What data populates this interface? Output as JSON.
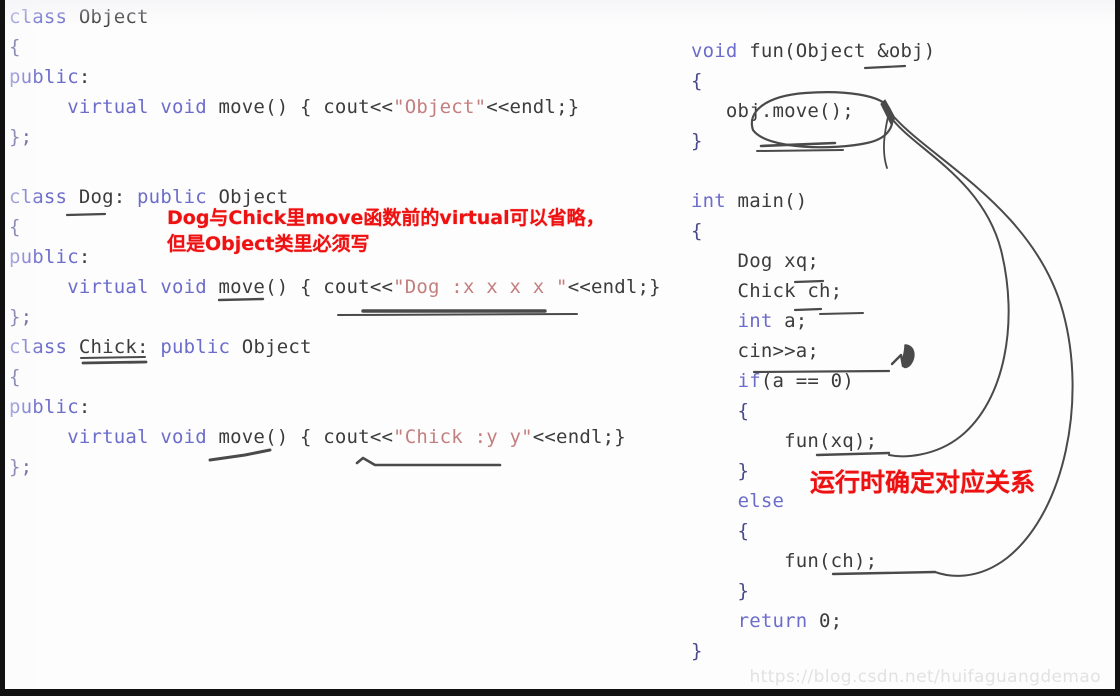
{
  "image": {
    "kind": "lecture-slide-screenshot",
    "topic": "C++ virtual functions / polymorphism",
    "background_color": "#fdfdfd",
    "border_color": "#111111"
  },
  "colors": {
    "keyword": "#6c6ccb",
    "identifier": "#3c3c3c",
    "string": "#c37f7f",
    "annotation_red": "#ee1111",
    "ink": "#4a4a4a",
    "watermark": "#e2e2e2"
  },
  "left_code": {
    "title": "class definitions",
    "lines": [
      [
        {
          "t": "class",
          "c": "kw"
        },
        {
          "t": " Object",
          "c": "id"
        }
      ],
      [
        {
          "t": "{",
          "c": "punct"
        }
      ],
      [
        {
          "t": "public",
          "c": "kw"
        },
        {
          "t": ":",
          "c": "id"
        }
      ],
      [
        {
          "t": "     ",
          "c": "id"
        },
        {
          "t": "virtual void",
          "c": "kw"
        },
        {
          "t": " move() { cout<<",
          "c": "id"
        },
        {
          "t": "\"Object\"",
          "c": "str"
        },
        {
          "t": "<<endl;}",
          "c": "id"
        }
      ],
      [
        {
          "t": "};",
          "c": "punct"
        }
      ],
      [],
      [
        {
          "t": "class",
          "c": "kw"
        },
        {
          "t": " Dog: ",
          "c": "id"
        },
        {
          "t": "public",
          "c": "kw"
        },
        {
          "t": " Object",
          "c": "id"
        }
      ],
      [
        {
          "t": "{",
          "c": "punct"
        }
      ],
      [
        {
          "t": "public",
          "c": "kw"
        },
        {
          "t": ":",
          "c": "id"
        }
      ],
      [
        {
          "t": "     ",
          "c": "id"
        },
        {
          "t": "virtual void",
          "c": "kw"
        },
        {
          "t": " move() { cout<<",
          "c": "id"
        },
        {
          "t": "\"Dog :x x x x \"",
          "c": "str"
        },
        {
          "t": "<<endl;}",
          "c": "id"
        }
      ],
      [
        {
          "t": "};",
          "c": "punct"
        }
      ],
      [
        {
          "t": "class",
          "c": "kw"
        },
        {
          "t": " Chick: ",
          "c": "id"
        },
        {
          "t": "public",
          "c": "kw"
        },
        {
          "t": " Object",
          "c": "id"
        }
      ],
      [
        {
          "t": "{",
          "c": "punct"
        }
      ],
      [
        {
          "t": "public",
          "c": "kw"
        },
        {
          "t": ":",
          "c": "id"
        }
      ],
      [
        {
          "t": "     ",
          "c": "id"
        },
        {
          "t": "virtual void",
          "c": "kw"
        },
        {
          "t": " move() { cout<<",
          "c": "id"
        },
        {
          "t": "\"Chick :y y\"",
          "c": "str"
        },
        {
          "t": "<<endl;}",
          "c": "id"
        }
      ],
      [
        {
          "t": "};",
          "c": "punct"
        }
      ]
    ]
  },
  "right_code": {
    "title": "fun() and main()",
    "lines": [
      [
        {
          "t": "void",
          "c": "kw"
        },
        {
          "t": " fun(Object &obj)",
          "c": "id"
        }
      ],
      [
        {
          "t": "{",
          "c": "punct"
        }
      ],
      [
        {
          "t": "   obj.move();",
          "c": "id"
        }
      ],
      [
        {
          "t": "}",
          "c": "punct"
        }
      ],
      [],
      [
        {
          "t": "int",
          "c": "kw"
        },
        {
          "t": " main()",
          "c": "id"
        }
      ],
      [
        {
          "t": "{",
          "c": "punct"
        }
      ],
      [
        {
          "t": "    Dog xq;",
          "c": "id"
        }
      ],
      [
        {
          "t": "    Chick ch;",
          "c": "id"
        }
      ],
      [
        {
          "t": "    ",
          "c": "id"
        },
        {
          "t": "int",
          "c": "kw"
        },
        {
          "t": " a;",
          "c": "id"
        }
      ],
      [
        {
          "t": "    cin>>a;",
          "c": "id"
        }
      ],
      [
        {
          "t": "    ",
          "c": "id"
        },
        {
          "t": "if",
          "c": "kw"
        },
        {
          "t": "(a == 0)",
          "c": "id"
        }
      ],
      [
        {
          "t": "    {",
          "c": "punct"
        }
      ],
      [
        {
          "t": "        fun(xq);",
          "c": "id"
        }
      ],
      [
        {
          "t": "    }",
          "c": "punct"
        }
      ],
      [
        {
          "t": "    ",
          "c": "id"
        },
        {
          "t": "else",
          "c": "kw"
        }
      ],
      [
        {
          "t": "    {",
          "c": "punct"
        }
      ],
      [
        {
          "t": "        fun(ch);",
          "c": "id"
        }
      ],
      [
        {
          "t": "    }",
          "c": "punct"
        }
      ],
      [
        {
          "t": "    ",
          "c": "id"
        },
        {
          "t": "return",
          "c": "kw"
        },
        {
          "t": " 0;",
          "c": "id"
        }
      ],
      [
        {
          "t": "}",
          "c": "punct"
        }
      ]
    ]
  },
  "annotations": {
    "left_note_line1": "Dog与Chick里move函数前的virtual可以省略，",
    "left_note_line2": "但是Object类里必须写",
    "right_note": "运行时确定对应关系"
  },
  "watermark": {
    "text": "https://blog.csdn.net/huifaguangdemao"
  }
}
